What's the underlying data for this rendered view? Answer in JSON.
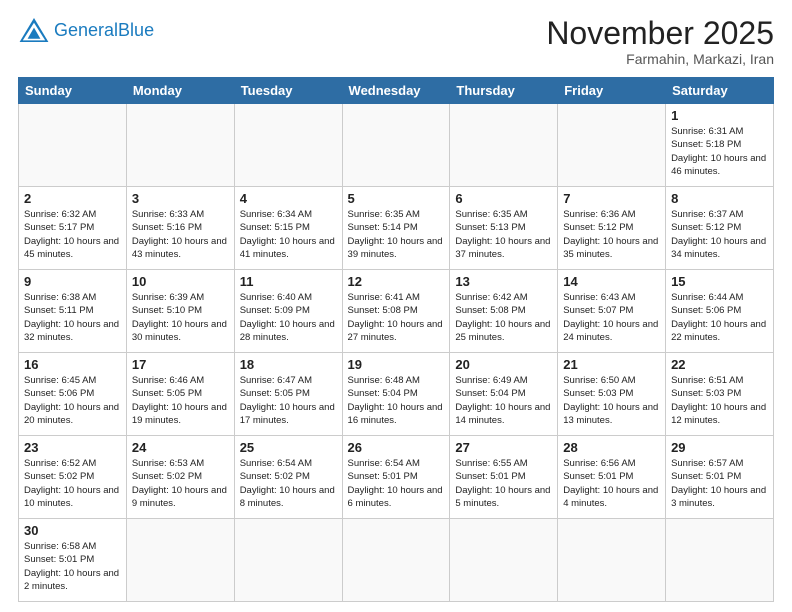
{
  "logo": {
    "text_general": "General",
    "text_blue": "Blue"
  },
  "header": {
    "month_year": "November 2025",
    "location": "Farmahin, Markazi, Iran"
  },
  "weekdays": [
    "Sunday",
    "Monday",
    "Tuesday",
    "Wednesday",
    "Thursday",
    "Friday",
    "Saturday"
  ],
  "weeks": [
    [
      {
        "day": "",
        "info": ""
      },
      {
        "day": "",
        "info": ""
      },
      {
        "day": "",
        "info": ""
      },
      {
        "day": "",
        "info": ""
      },
      {
        "day": "",
        "info": ""
      },
      {
        "day": "",
        "info": ""
      },
      {
        "day": "1",
        "info": "Sunrise: 6:31 AM\nSunset: 5:18 PM\nDaylight: 10 hours and 46 minutes."
      }
    ],
    [
      {
        "day": "2",
        "info": "Sunrise: 6:32 AM\nSunset: 5:17 PM\nDaylight: 10 hours and 45 minutes."
      },
      {
        "day": "3",
        "info": "Sunrise: 6:33 AM\nSunset: 5:16 PM\nDaylight: 10 hours and 43 minutes."
      },
      {
        "day": "4",
        "info": "Sunrise: 6:34 AM\nSunset: 5:15 PM\nDaylight: 10 hours and 41 minutes."
      },
      {
        "day": "5",
        "info": "Sunrise: 6:35 AM\nSunset: 5:14 PM\nDaylight: 10 hours and 39 minutes."
      },
      {
        "day": "6",
        "info": "Sunrise: 6:35 AM\nSunset: 5:13 PM\nDaylight: 10 hours and 37 minutes."
      },
      {
        "day": "7",
        "info": "Sunrise: 6:36 AM\nSunset: 5:12 PM\nDaylight: 10 hours and 35 minutes."
      },
      {
        "day": "8",
        "info": "Sunrise: 6:37 AM\nSunset: 5:12 PM\nDaylight: 10 hours and 34 minutes."
      }
    ],
    [
      {
        "day": "9",
        "info": "Sunrise: 6:38 AM\nSunset: 5:11 PM\nDaylight: 10 hours and 32 minutes."
      },
      {
        "day": "10",
        "info": "Sunrise: 6:39 AM\nSunset: 5:10 PM\nDaylight: 10 hours and 30 minutes."
      },
      {
        "day": "11",
        "info": "Sunrise: 6:40 AM\nSunset: 5:09 PM\nDaylight: 10 hours and 28 minutes."
      },
      {
        "day": "12",
        "info": "Sunrise: 6:41 AM\nSunset: 5:08 PM\nDaylight: 10 hours and 27 minutes."
      },
      {
        "day": "13",
        "info": "Sunrise: 6:42 AM\nSunset: 5:08 PM\nDaylight: 10 hours and 25 minutes."
      },
      {
        "day": "14",
        "info": "Sunrise: 6:43 AM\nSunset: 5:07 PM\nDaylight: 10 hours and 24 minutes."
      },
      {
        "day": "15",
        "info": "Sunrise: 6:44 AM\nSunset: 5:06 PM\nDaylight: 10 hours and 22 minutes."
      }
    ],
    [
      {
        "day": "16",
        "info": "Sunrise: 6:45 AM\nSunset: 5:06 PM\nDaylight: 10 hours and 20 minutes."
      },
      {
        "day": "17",
        "info": "Sunrise: 6:46 AM\nSunset: 5:05 PM\nDaylight: 10 hours and 19 minutes."
      },
      {
        "day": "18",
        "info": "Sunrise: 6:47 AM\nSunset: 5:05 PM\nDaylight: 10 hours and 17 minutes."
      },
      {
        "day": "19",
        "info": "Sunrise: 6:48 AM\nSunset: 5:04 PM\nDaylight: 10 hours and 16 minutes."
      },
      {
        "day": "20",
        "info": "Sunrise: 6:49 AM\nSunset: 5:04 PM\nDaylight: 10 hours and 14 minutes."
      },
      {
        "day": "21",
        "info": "Sunrise: 6:50 AM\nSunset: 5:03 PM\nDaylight: 10 hours and 13 minutes."
      },
      {
        "day": "22",
        "info": "Sunrise: 6:51 AM\nSunset: 5:03 PM\nDaylight: 10 hours and 12 minutes."
      }
    ],
    [
      {
        "day": "23",
        "info": "Sunrise: 6:52 AM\nSunset: 5:02 PM\nDaylight: 10 hours and 10 minutes."
      },
      {
        "day": "24",
        "info": "Sunrise: 6:53 AM\nSunset: 5:02 PM\nDaylight: 10 hours and 9 minutes."
      },
      {
        "day": "25",
        "info": "Sunrise: 6:54 AM\nSunset: 5:02 PM\nDaylight: 10 hours and 8 minutes."
      },
      {
        "day": "26",
        "info": "Sunrise: 6:54 AM\nSunset: 5:01 PM\nDaylight: 10 hours and 6 minutes."
      },
      {
        "day": "27",
        "info": "Sunrise: 6:55 AM\nSunset: 5:01 PM\nDaylight: 10 hours and 5 minutes."
      },
      {
        "day": "28",
        "info": "Sunrise: 6:56 AM\nSunset: 5:01 PM\nDaylight: 10 hours and 4 minutes."
      },
      {
        "day": "29",
        "info": "Sunrise: 6:57 AM\nSunset: 5:01 PM\nDaylight: 10 hours and 3 minutes."
      }
    ],
    [
      {
        "day": "30",
        "info": "Sunrise: 6:58 AM\nSunset: 5:01 PM\nDaylight: 10 hours and 2 minutes."
      },
      {
        "day": "",
        "info": ""
      },
      {
        "day": "",
        "info": ""
      },
      {
        "day": "",
        "info": ""
      },
      {
        "day": "",
        "info": ""
      },
      {
        "day": "",
        "info": ""
      },
      {
        "day": "",
        "info": ""
      }
    ]
  ]
}
